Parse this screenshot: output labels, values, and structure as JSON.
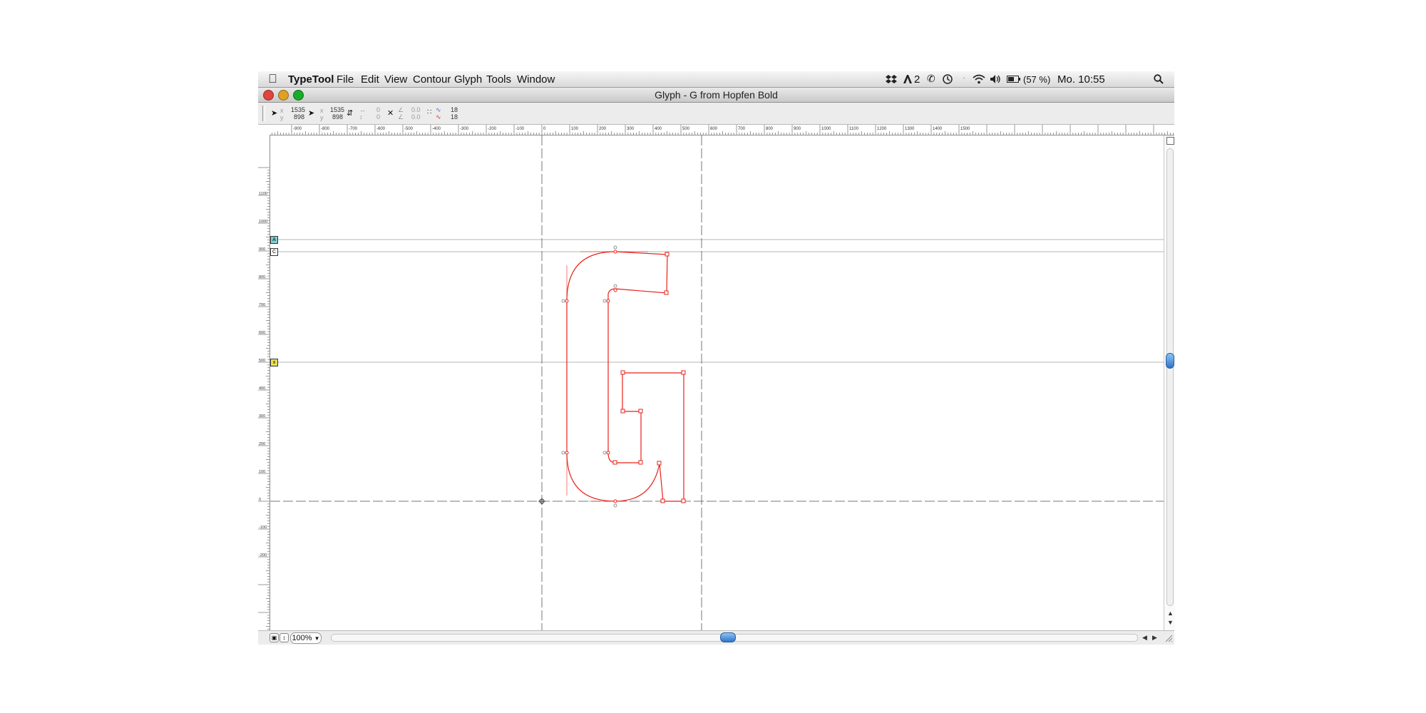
{
  "menubar": {
    "apple_icon": "apple-logo-icon",
    "items": [
      {
        "label": "TypeTool"
      },
      {
        "label": "File"
      },
      {
        "label": "Edit"
      },
      {
        "label": "View"
      },
      {
        "label": "Contour"
      },
      {
        "label": "Glyph"
      },
      {
        "label": "Tools"
      },
      {
        "label": "Window"
      }
    ],
    "status": {
      "adobe_badge": "2",
      "battery": "(57 %)",
      "clock": "Mo. 10:55"
    }
  },
  "window": {
    "title": "Glyph - G from Hopfen Bold",
    "close_color": "#e0443e",
    "min_color": "#dea123",
    "max_color": "#1aab29"
  },
  "toolbar": {
    "cursor_x": "1535",
    "cursor_y": "898",
    "node_x": "1535",
    "node_y": "898",
    "dist_h": "0",
    "dist_v": "0",
    "angle_a": "0.0",
    "angle_b": "0.0",
    "grid_a": "18",
    "grid_b": "18",
    "label_x": "x",
    "label_y": "y"
  },
  "rulers": {
    "h_labels": [
      "-900",
      "-800",
      "-700",
      "-600",
      "-500",
      "-400",
      "-300",
      "-200",
      "-100",
      "0",
      "100",
      "200",
      "300",
      "400",
      "500",
      "600",
      "700",
      "800",
      "900",
      "1000",
      "1100",
      "1200",
      "1300",
      "1400",
      "1500"
    ],
    "v_labels": [
      "1100",
      "1000",
      "900",
      "800",
      "700",
      "600",
      "500",
      "400",
      "300",
      "200",
      "100",
      "0",
      "-100",
      "-200"
    ]
  },
  "guides": {
    "ascender_badge": "A",
    "caps_badge": "C",
    "xheight_badge": "x"
  },
  "glyph": {
    "name": "G",
    "outline_color": "#e8221a"
  },
  "bottombar": {
    "zoom": "100%",
    "zoom_arrow": "▼"
  }
}
